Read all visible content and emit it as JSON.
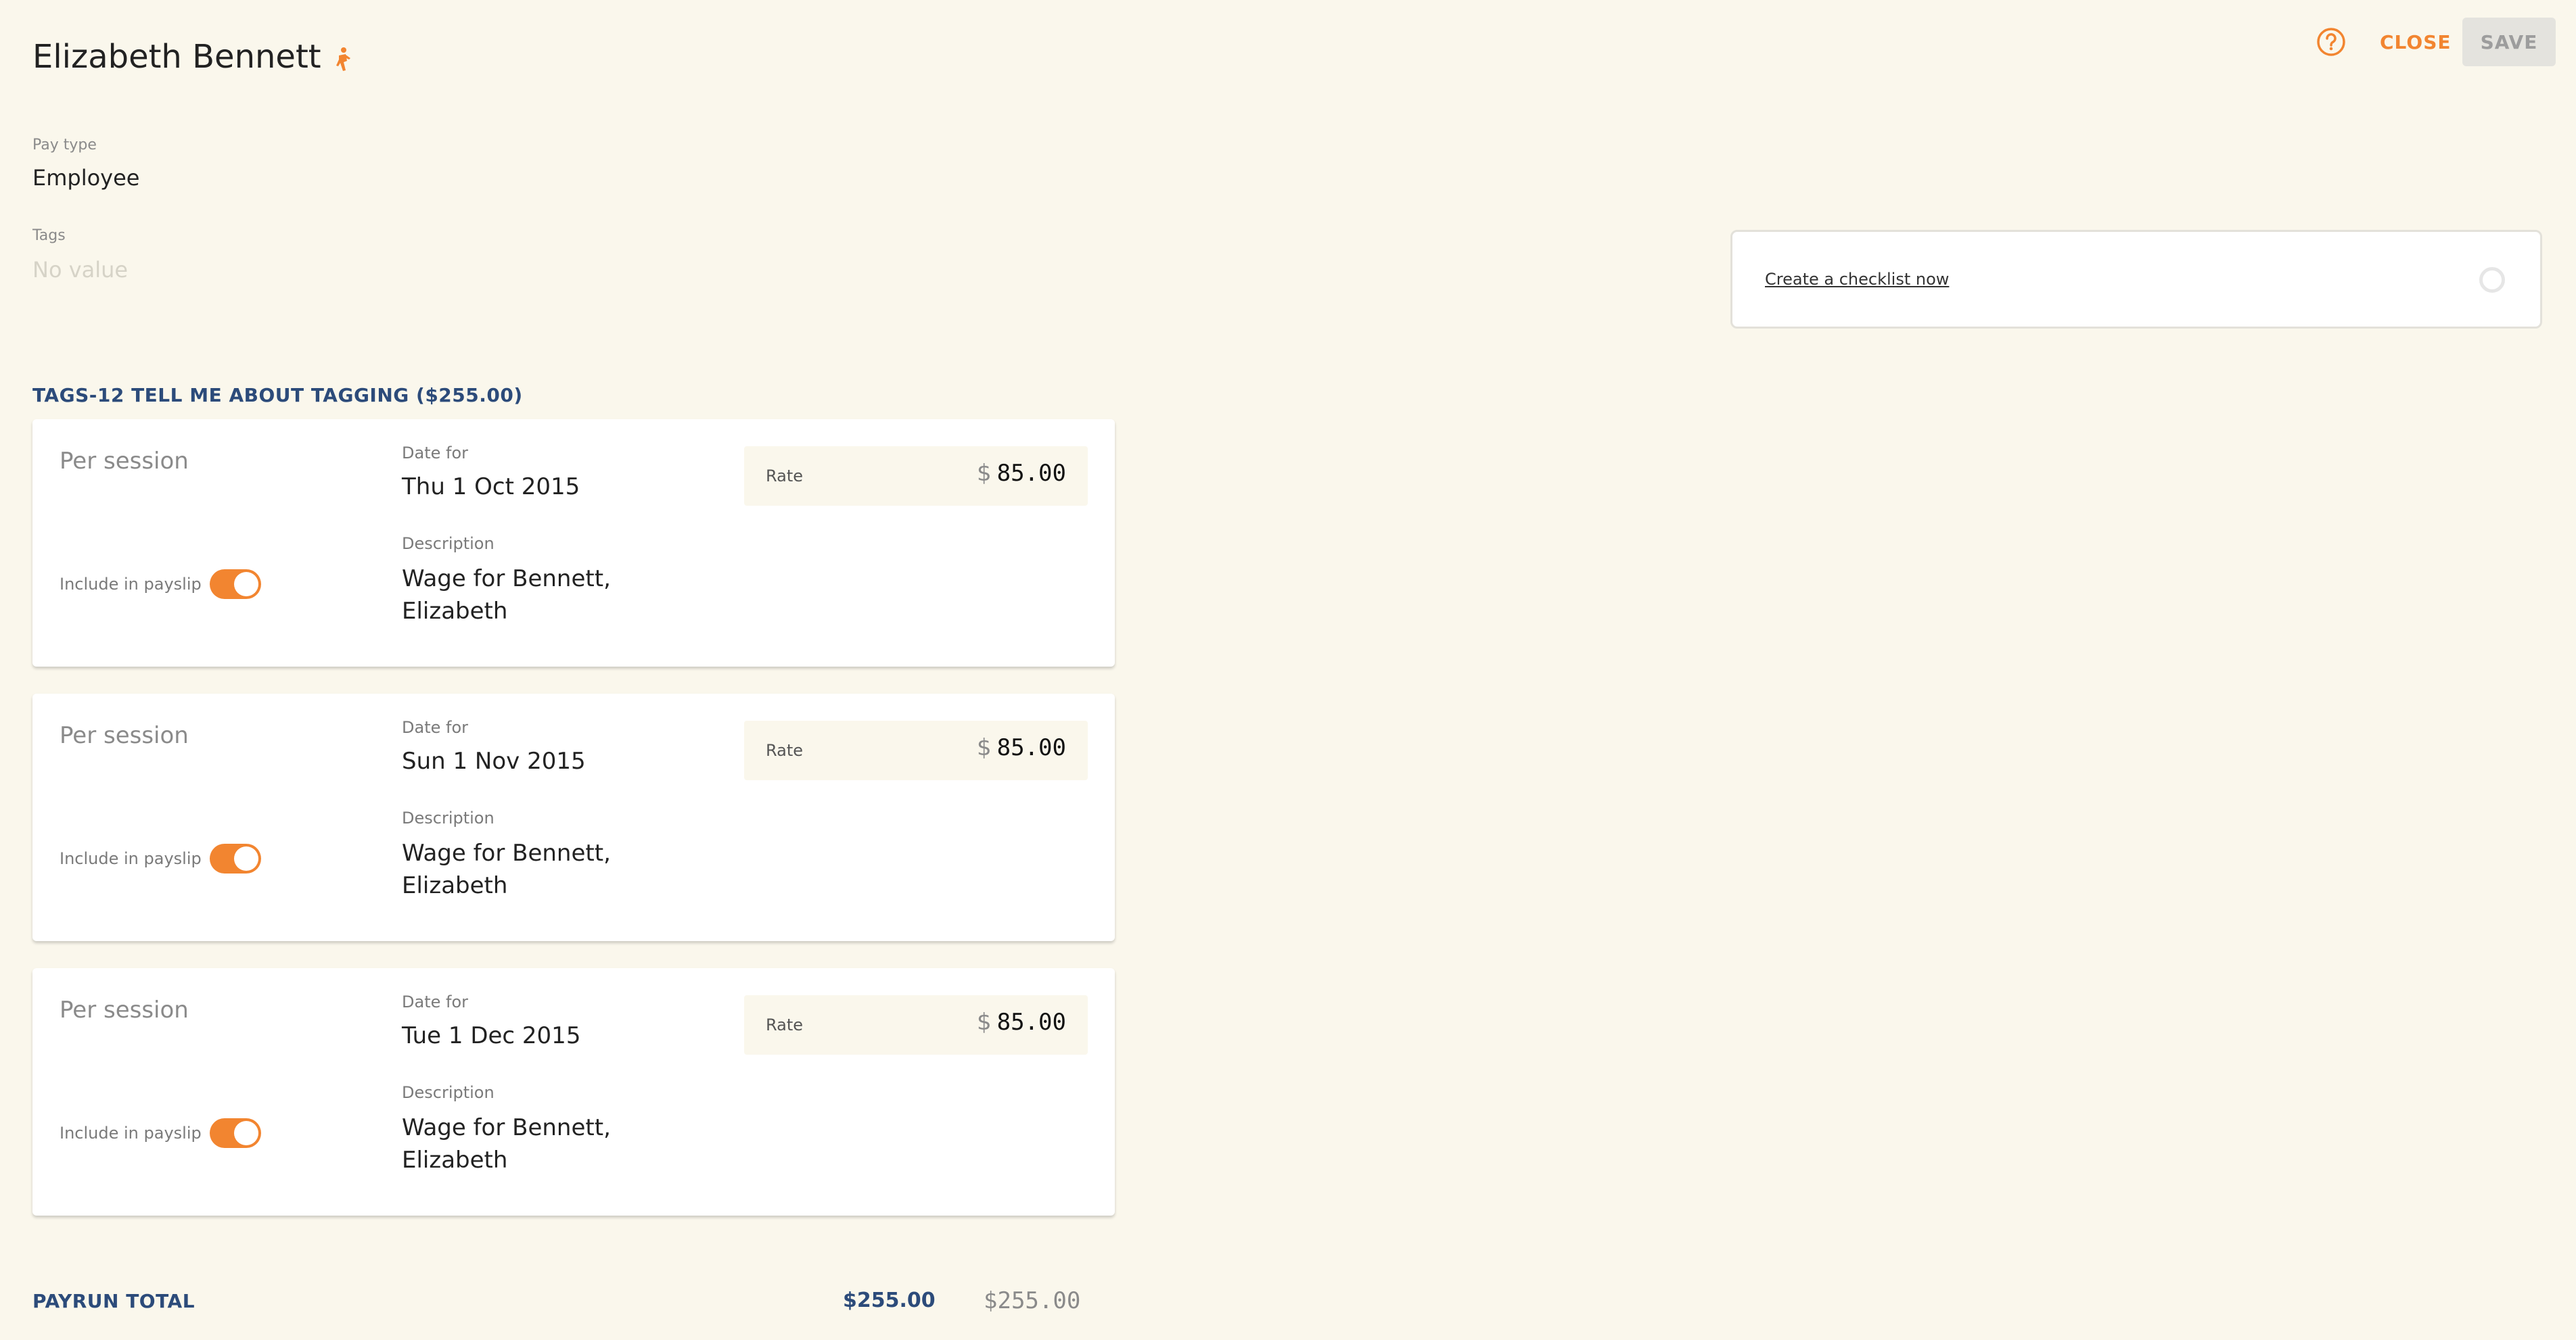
{
  "header": {
    "name": "Elizabeth Bennett",
    "person_icon": "person-walking-icon",
    "help_icon": "help-circle-icon",
    "close_label": "CLOSE",
    "save_label": "SAVE"
  },
  "fields": {
    "pay_type_label": "Pay type",
    "pay_type_value": "Employee",
    "tags_label": "Tags",
    "tags_placeholder": "No value"
  },
  "checklist": {
    "link_label": "Create a checklist now"
  },
  "section": {
    "title": "TAGS-12 TELL ME ABOUT TAGGING ($255.00)"
  },
  "items": [
    {
      "kind": "Per session",
      "include_label": "Include in payslip",
      "include": true,
      "date_label": "Date for",
      "date": "Thu 1 Oct 2015",
      "description_label": "Description",
      "description": "Wage for Bennett, Elizabeth",
      "rate_label": "Rate",
      "currency": "$",
      "rate": "85.00"
    },
    {
      "kind": "Per session",
      "include_label": "Include in payslip",
      "include": true,
      "date_label": "Date for",
      "date": "Sun 1 Nov 2015",
      "description_label": "Description",
      "description": "Wage for Bennett, Elizabeth",
      "rate_label": "Rate",
      "currency": "$",
      "rate": "85.00"
    },
    {
      "kind": "Per session",
      "include_label": "Include in payslip",
      "include": true,
      "date_label": "Date for",
      "date": "Tue 1 Dec 2015",
      "description_label": "Description",
      "description": "Wage for Bennett, Elizabeth",
      "rate_label": "Rate",
      "currency": "$",
      "rate": "85.00"
    }
  ],
  "footer": {
    "total_label": "PAYRUN TOTAL",
    "total_primary": "$255.00",
    "total_secondary": "$255.00"
  },
  "colors": {
    "background": "#faf7ec",
    "accent": "#f28530",
    "heading": "#2c4b7a"
  }
}
